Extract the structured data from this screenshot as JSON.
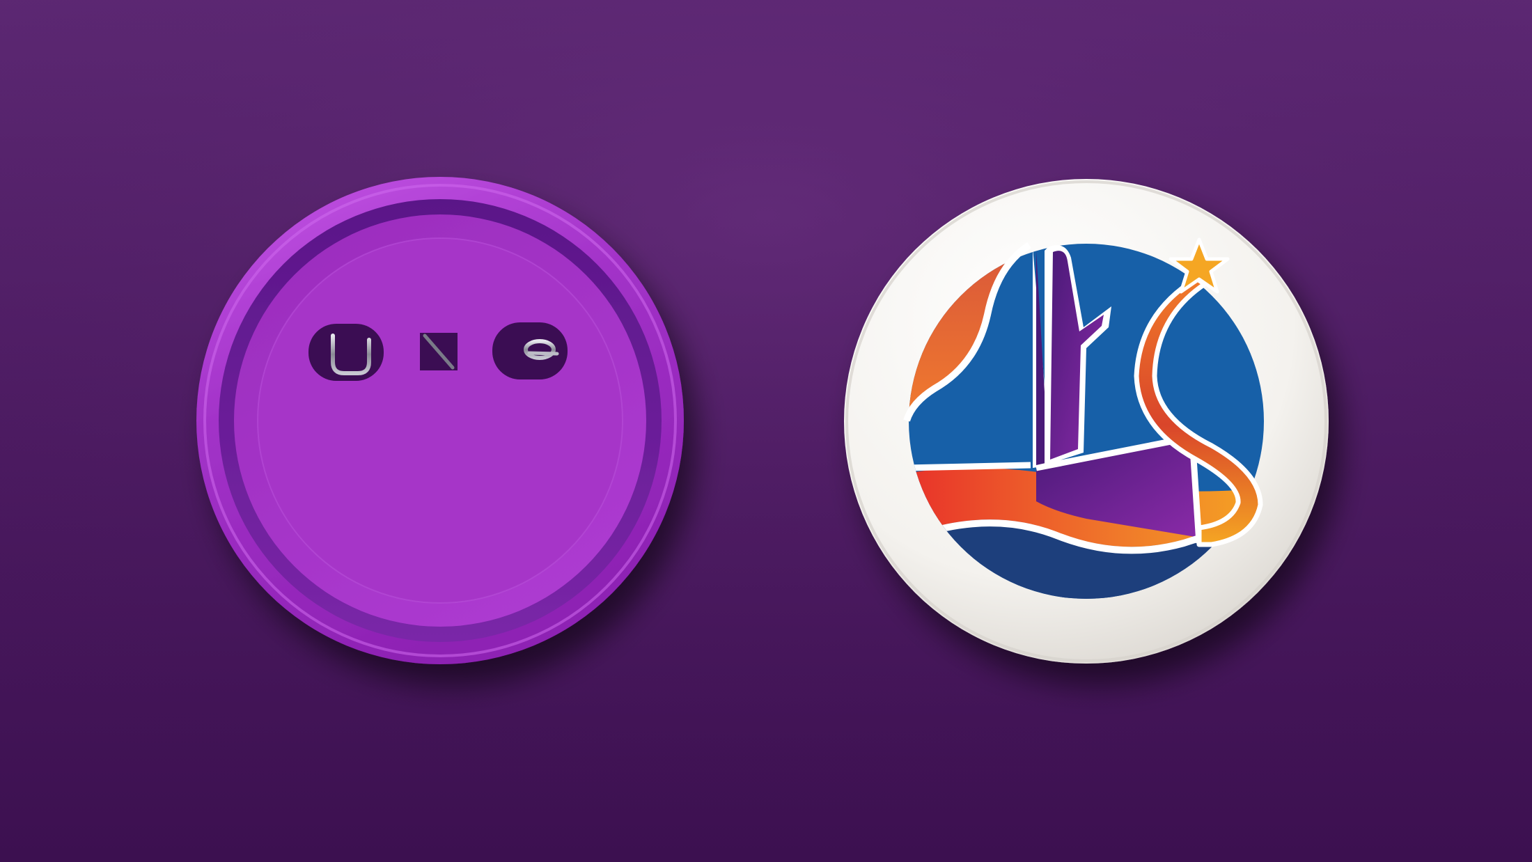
{
  "scene": {
    "description_items": [
      "button-back",
      "button-front"
    ]
  },
  "colors": {
    "background_top": "#5f2a76",
    "background_bottom": "#3c1050",
    "back_rim": "#a23cc8",
    "back_inner": "#9e30c0",
    "front_face": "#f4f2ee",
    "logo_orange": "#e0633a",
    "logo_blue": "#1760a8",
    "logo_navy": "#1d3f7c",
    "logo_purple": "#6a2590",
    "logo_red": "#e8322a",
    "logo_star": "#f5a623"
  },
  "icons": {
    "pin": "safety-pin-icon",
    "logo": "landmark-star-logo-icon"
  }
}
